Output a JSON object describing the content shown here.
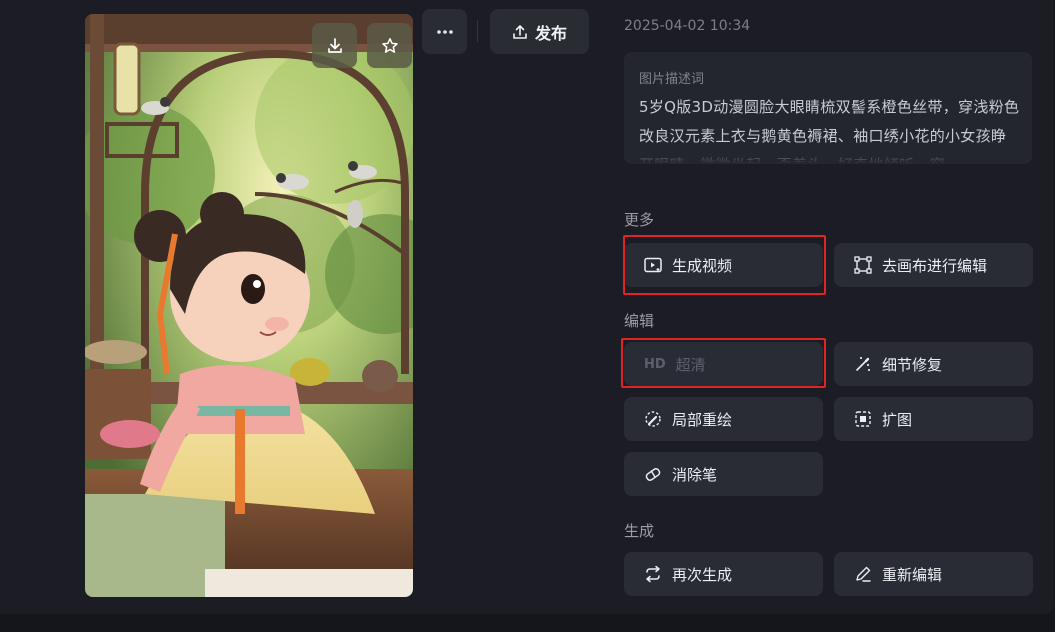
{
  "colors": {
    "highlight": "#e02424",
    "panel_bg": "#1c1d24",
    "button_bg": "#2a2c35"
  },
  "image": {
    "subject": "3D cartoon girl in pink hanfu seated by a round window with birds"
  },
  "image_toolbar": {
    "download_icon": "download-icon",
    "favorite_icon": "star-icon"
  },
  "toolbar": {
    "more_icon": "more-dots-icon",
    "publish_label": "发布",
    "publish_icon": "upload-icon"
  },
  "timestamp": "2025-04-02 10:34",
  "description": {
    "label": "图片描述词",
    "text": "5岁Q版3D动漫圆脸大眼睛梳双髻系橙色丝带，穿浅粉色改良汉元素上衣与鹅黄色褥裙、袖口绣小花的小女孩睁开眼睛，微微坐起，歪着头，好奇地倾听，窗"
  },
  "sections": {
    "more": {
      "title": "更多",
      "generate_video": "生成视频",
      "canvas_edit": "去画布进行编辑"
    },
    "edit": {
      "title": "编辑",
      "hd_badge": "HD",
      "hd_label": "超清",
      "detail_repair": "细节修复",
      "partial_redraw": "局部重绘",
      "expand": "扩图",
      "eraser": "消除笔"
    },
    "generate": {
      "title": "生成",
      "regenerate": "再次生成",
      "re_edit": "重新编辑"
    }
  }
}
